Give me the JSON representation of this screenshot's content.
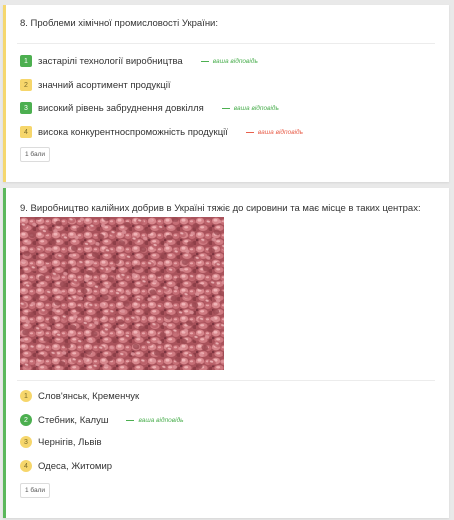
{
  "colors": {
    "correct": "#4caf50",
    "incorrect": "#e8604c",
    "option_badge": "#f6d66b",
    "card1_bar": "#f5d76e",
    "card2_bar": "#5cb85c"
  },
  "questions": [
    {
      "title": "8. Проблеми хімічної промисловості України:",
      "options": [
        {
          "num": "1",
          "text": "застарілі технології виробництва",
          "status": "correct",
          "note": "ваша відповідь"
        },
        {
          "num": "2",
          "text": "значний асортимент продукції",
          "status": "none",
          "note": ""
        },
        {
          "num": "3",
          "text": "високий рівень забруднення довкілля",
          "status": "correct",
          "note": "ваша відповідь"
        },
        {
          "num": "4",
          "text": "висока конкурентноспроможність продукції",
          "status": "incorrect",
          "note": "ваша відповідь"
        }
      ],
      "points": "1 бали"
    },
    {
      "title": "9. Виробництво калійних добрив в Україні тяжіє до сировини та має місце в таких центрах:",
      "image_icon": "potash-granules-photo",
      "options": [
        {
          "num": "1",
          "text": "Слов'янськ, Кременчук",
          "status": "none",
          "note": ""
        },
        {
          "num": "2",
          "text": "Стебник, Калуш",
          "status": "correct",
          "note": "ваша відповідь"
        },
        {
          "num": "3",
          "text": "Чернігів, Львів",
          "status": "none",
          "note": ""
        },
        {
          "num": "4",
          "text": "Одеса, Житомир",
          "status": "none",
          "note": ""
        }
      ],
      "points": "1 бали"
    }
  ]
}
